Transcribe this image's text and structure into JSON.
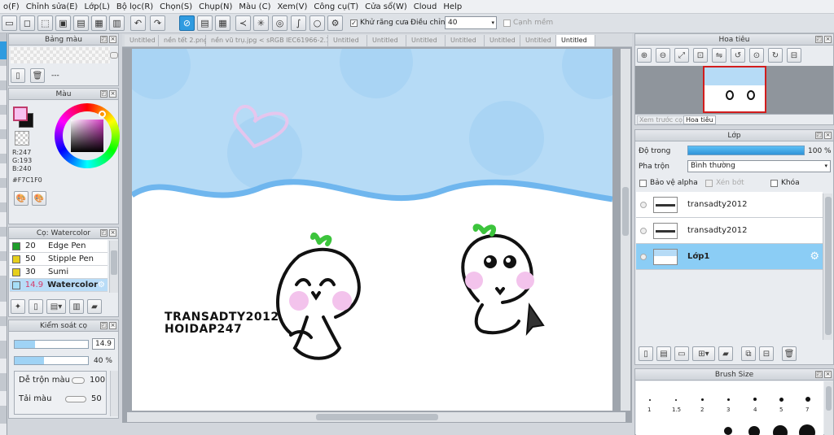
{
  "menubar": {
    "items": [
      "o(F)",
      "Chỉnh sửa(E)",
      "Lớp(L)",
      "Bộ lọc(R)",
      "Chọn(S)",
      "Chụp(N)",
      "Màu (C)",
      "Xem(V)",
      "Công cụ(T)",
      "Cửa sổ(W)",
      "Cloud",
      "Help"
    ]
  },
  "toolbar": {
    "antialias_label": "Khử răng cưa",
    "adjust_label": "Điều chỉnh",
    "adjust_value": "40",
    "smooth_label": "Cạnh mềm"
  },
  "left_panels": {
    "brush_shape_title": "Bảng màu",
    "brush_shape_value": "---",
    "color_title": "Màu",
    "color_r": "R:247",
    "color_g": "G:193",
    "color_b": "B:240",
    "color_hex": "#F7C1F0",
    "brush_list_title": "Cọ: Watercolor",
    "brushes": [
      {
        "size": "20",
        "name": "Edge Pen"
      },
      {
        "size": "50",
        "name": "Stipple Pen"
      },
      {
        "size": "30",
        "name": "Sumi"
      },
      {
        "size": "14.9",
        "name": "Watercolor"
      }
    ],
    "brush_control_title": "Kiểm soát cọ",
    "brush_size_value": "14.9",
    "opacity_value": "40 %",
    "blend_label": "Dễ trộn màu",
    "blend_value": "100",
    "load_label": "Tải màu",
    "load_value": "50"
  },
  "tabs": [
    "Untitled",
    "nền tết 2.png",
    "nền vũ trụ.jpg < sRGB IEC61966-2.1 >",
    "Untitled",
    "Untitled",
    "Untitled",
    "Untitled",
    "Untitled",
    "Untitled",
    "Untitled"
  ],
  "canvas": {
    "text_line1": "TRANSADTY2012",
    "text_line2": "HOIDAP247"
  },
  "navigator": {
    "title": "Hoa tiêu",
    "tab_preview": "Xem trước cọ",
    "tab_nav": "Hoa tiêu"
  },
  "layers": {
    "title": "Lớp",
    "opacity_label": "Độ trong",
    "opacity_value": "100 %",
    "opacity_fraction": 1.0,
    "blend_label": "Pha trộn",
    "blend_value": "Bình thường",
    "protect_alpha": "Bảo vệ alpha",
    "clip": "Xén bớt",
    "lock": "Khóa",
    "items": [
      {
        "name": "transadty2012"
      },
      {
        "name": "transadty2012"
      },
      {
        "name": "Lớp1"
      }
    ]
  },
  "brush_size_panel": {
    "title": "Brush Size",
    "sizes": [
      "1",
      "1.5",
      "2",
      "3",
      "4",
      "5",
      "7"
    ]
  },
  "colors": {
    "accent": "#2f9be0",
    "sky": "#b6dbf6",
    "current_color": "#F7C1F0"
  }
}
